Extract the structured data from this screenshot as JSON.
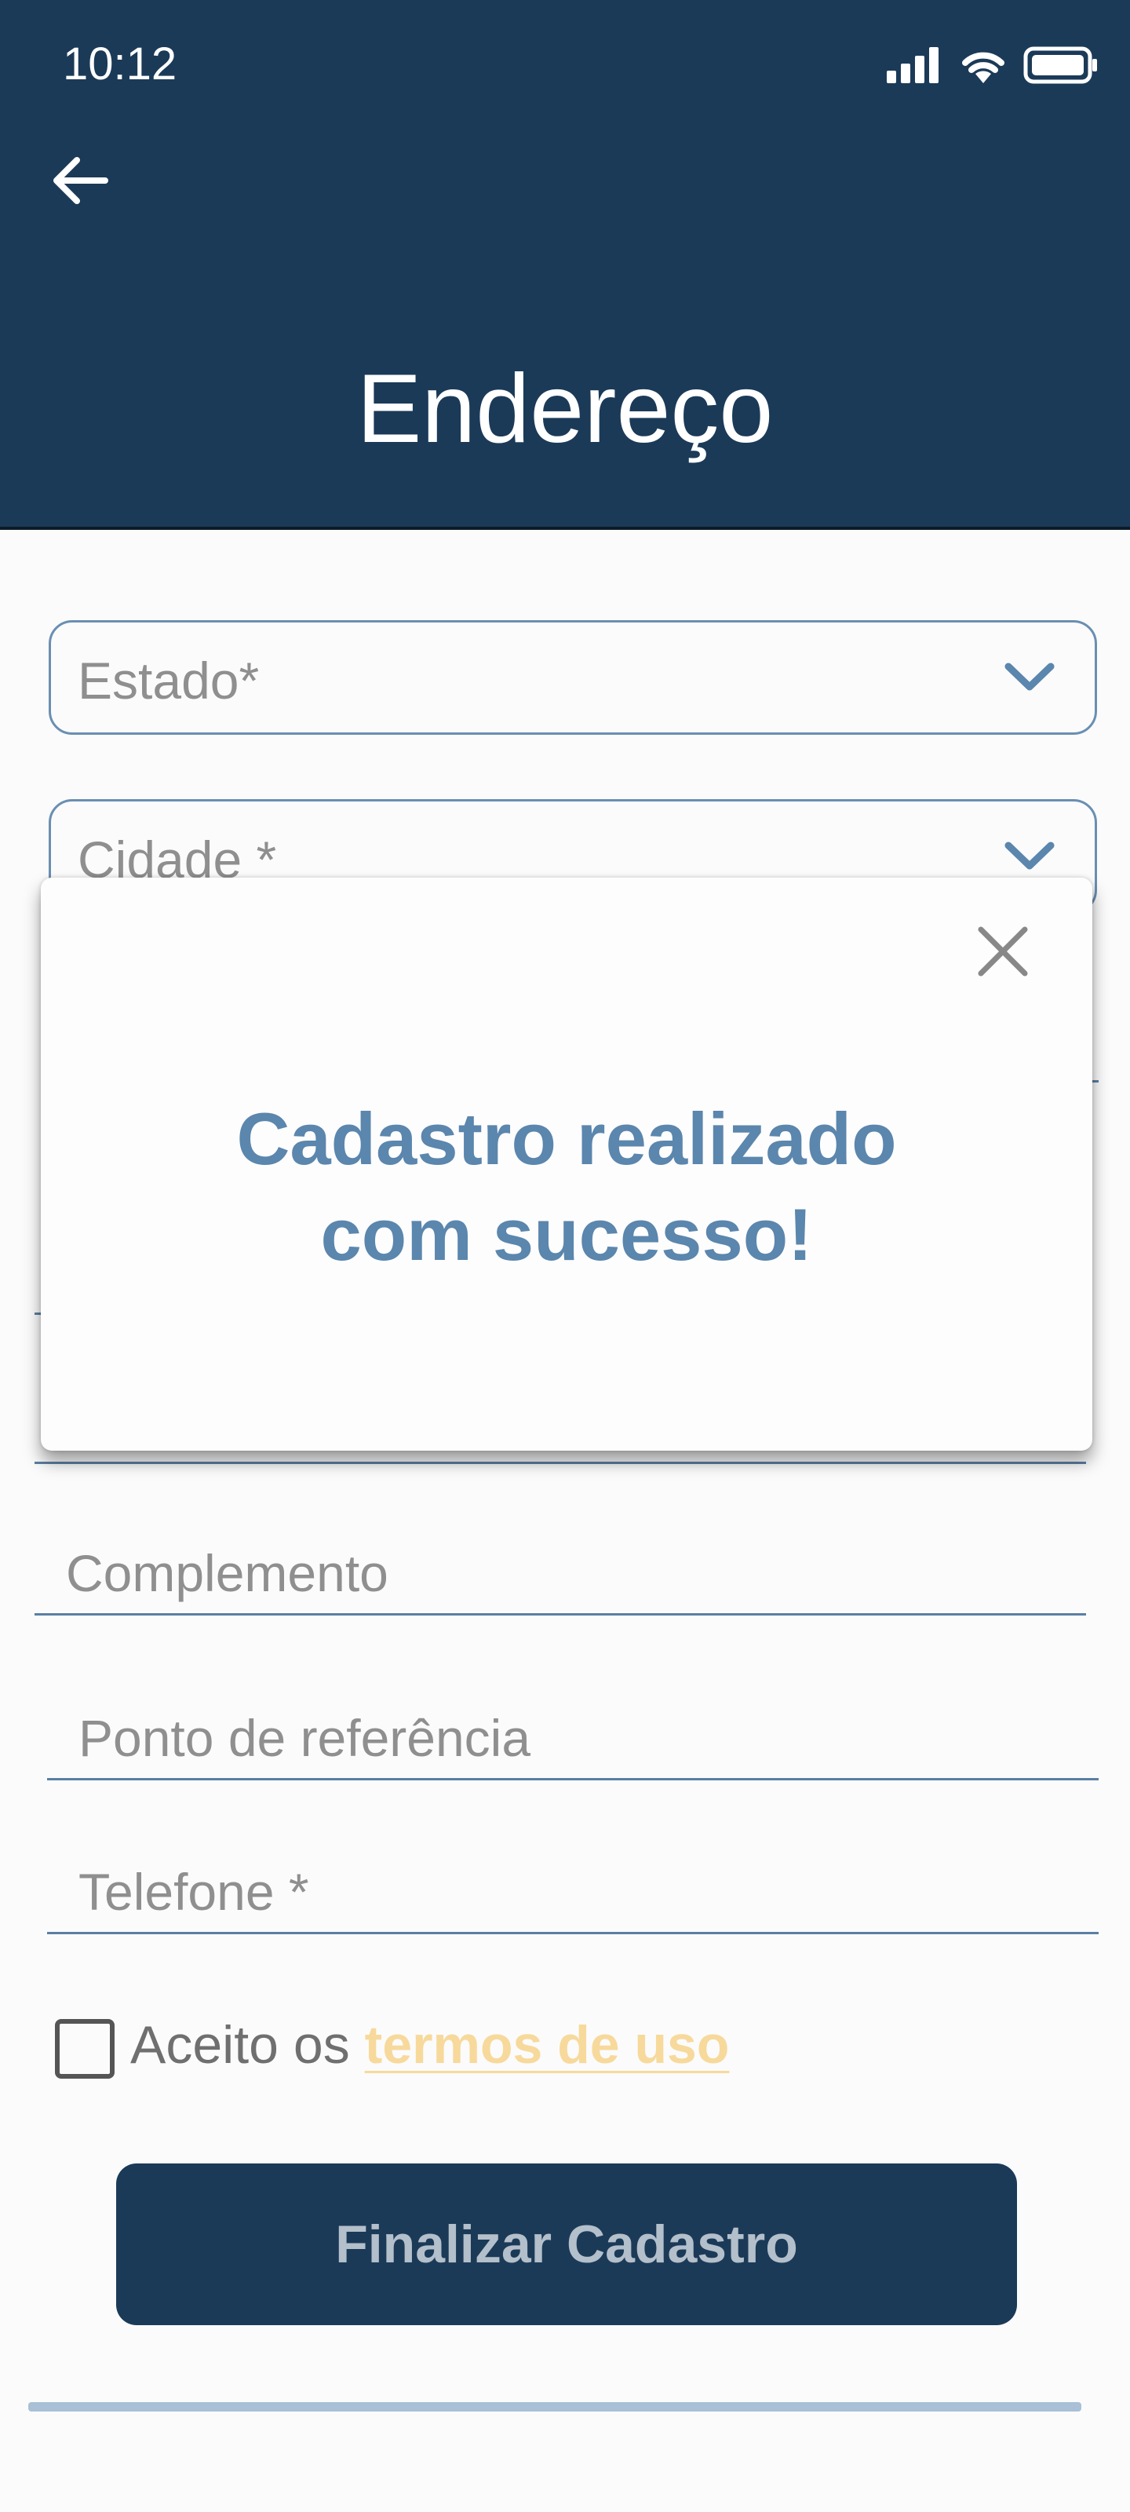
{
  "status_bar": {
    "time": "10:12"
  },
  "header": {
    "title": "Endereço",
    "back_icon": "arrow-left-icon"
  },
  "form": {
    "estado_label": "Estado*",
    "cidade_label": "Cidade *",
    "complemento_placeholder": "Complemento",
    "referencia_placeholder": "Ponto de referência",
    "telefone_placeholder": "Telefone *",
    "terms_prefix": "Aceito os ",
    "terms_link": "termos de uso",
    "submit_label": "Finalizar Cadastro"
  },
  "modal": {
    "message_line1": "Cadastro realizado",
    "message_line2": "com sucesso!",
    "close_icon": "close-icon"
  },
  "colors": {
    "primary": "#1b3a58",
    "accent": "#5b86ad",
    "link": "#f7d99b"
  }
}
